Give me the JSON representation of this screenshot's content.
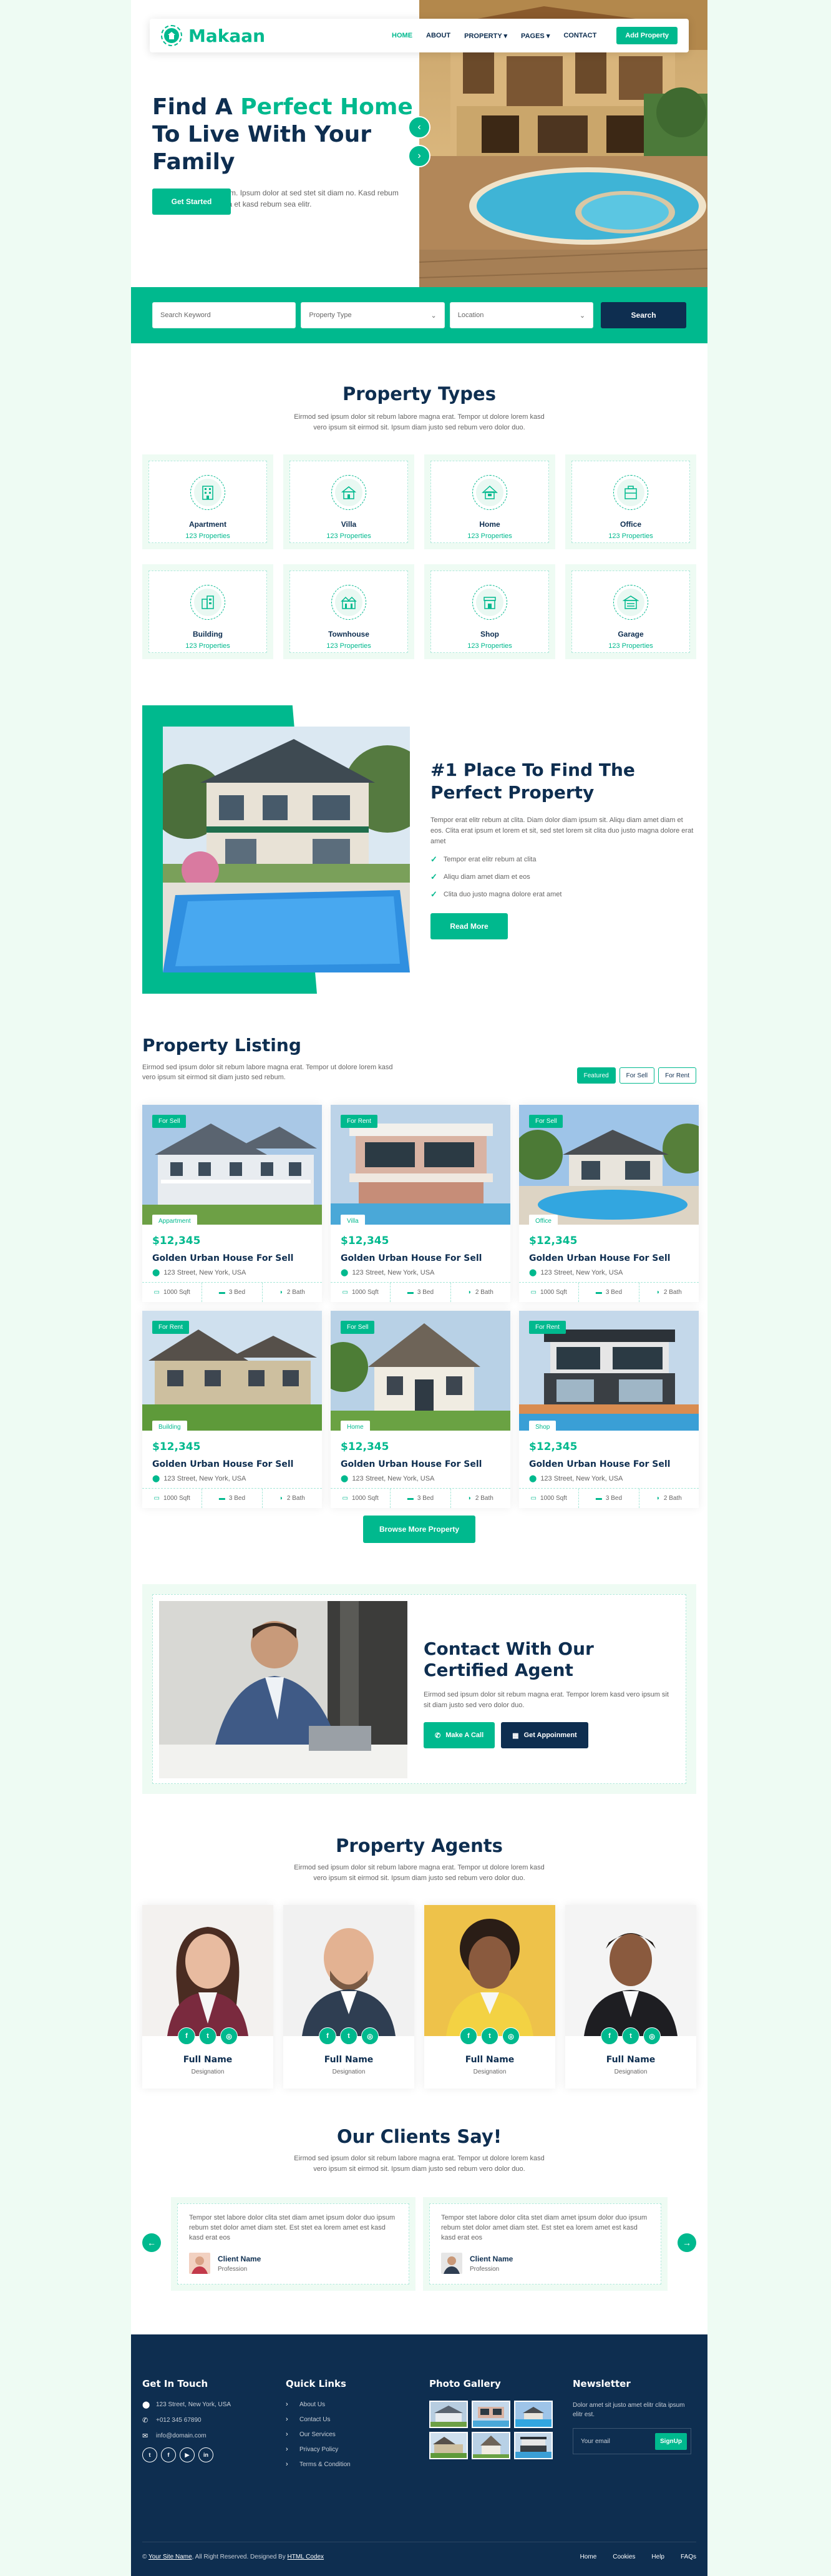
{
  "nav": {
    "brand": "Makaan",
    "links": [
      "HOME",
      "ABOUT",
      "PROPERTY",
      "PAGES",
      "CONTACT"
    ],
    "add_button": "Add Property"
  },
  "hero": {
    "title_part1": "Find A ",
    "title_highlight": "Perfect Home",
    "title_part2": " To Live With Your Family",
    "description": "Vero elitr justo clita lorem. Ipsum dolor at sed stet sit diam no. Kasd rebum ipsum et diam justo clita et kasd rebum sea elitr.",
    "button": "Get Started",
    "arrow_prev": "‹",
    "arrow_next": "›"
  },
  "search": {
    "keyword_placeholder": "Search Keyword",
    "type_select": "Property Type",
    "location_select": "Location",
    "button": "Search"
  },
  "types": {
    "title": "Property Types",
    "subtitle": "Eirmod sed ipsum dolor sit rebum labore magna erat. Tempor ut dolore lorem kasd vero ipsum sit eirmod sit. Ipsum diam justo sed rebum vero dolor duo.",
    "items": [
      {
        "name": "Apartment",
        "count": "123 Properties"
      },
      {
        "name": "Villa",
        "count": "123 Properties"
      },
      {
        "name": "Home",
        "count": "123 Properties"
      },
      {
        "name": "Office",
        "count": "123 Properties"
      },
      {
        "name": "Building",
        "count": "123 Properties"
      },
      {
        "name": "Townhouse",
        "count": "123 Properties"
      },
      {
        "name": "Shop",
        "count": "123 Properties"
      },
      {
        "name": "Garage",
        "count": "123 Properties"
      }
    ]
  },
  "about": {
    "title": "#1 Place To Find The Perfect Property",
    "description": "Tempor erat elitr rebum at clita. Diam dolor diam ipsum sit. Aliqu diam amet diam et eos. Clita erat ipsum et lorem et sit, sed stet lorem sit clita duo justo magna dolore erat amet",
    "checks": [
      "Tempor erat elitr rebum at clita",
      "Aliqu diam amet diam et eos",
      "Clita duo justo magna dolore erat amet"
    ],
    "button": "Read More"
  },
  "listing": {
    "title": "Property Listing",
    "subtitle": "Eirmod sed ipsum dolor sit rebum labore magna erat. Tempor ut dolore lorem kasd vero ipsum sit eirmod sit diam justo sed rebum.",
    "filters": [
      "Featured",
      "For Sell",
      "For Rent"
    ],
    "cards": [
      {
        "tag": "For Sell",
        "type": "Appartment",
        "price": "$12,345",
        "name": "Golden Urban House For Sell",
        "address": "123 Street, New York, USA",
        "sqft": "1000 Sqft",
        "bed": "3 Bed",
        "bath": "2 Bath"
      },
      {
        "tag": "For Rent",
        "type": "Villa",
        "price": "$12,345",
        "name": "Golden Urban House For Sell",
        "address": "123 Street, New York, USA",
        "sqft": "1000 Sqft",
        "bed": "3 Bed",
        "bath": "2 Bath"
      },
      {
        "tag": "For Sell",
        "type": "Office",
        "price": "$12,345",
        "name": "Golden Urban House For Sell",
        "address": "123 Street, New York, USA",
        "sqft": "1000 Sqft",
        "bed": "3 Bed",
        "bath": "2 Bath"
      },
      {
        "tag": "For Rent",
        "type": "Building",
        "price": "$12,345",
        "name": "Golden Urban House For Sell",
        "address": "123 Street, New York, USA",
        "sqft": "1000 Sqft",
        "bed": "3 Bed",
        "bath": "2 Bath"
      },
      {
        "tag": "For Sell",
        "type": "Home",
        "price": "$12,345",
        "name": "Golden Urban House For Sell",
        "address": "123 Street, New York, USA",
        "sqft": "1000 Sqft",
        "bed": "3 Bed",
        "bath": "2 Bath"
      },
      {
        "tag": "For Rent",
        "type": "Shop",
        "price": "$12,345",
        "name": "Golden Urban House For Sell",
        "address": "123 Street, New York, USA",
        "sqft": "1000 Sqft",
        "bed": "3 Bed",
        "bath": "2 Bath"
      }
    ],
    "browse_button": "Browse More Property"
  },
  "contact": {
    "title": "Contact With Our Certified Agent",
    "description": "Eirmod sed ipsum dolor sit rebum magna erat. Tempor lorem kasd vero ipsum sit sit diam justo sed vero dolor duo.",
    "call_button": "Make A Call",
    "appointment_button": "Get Appoinment"
  },
  "agents": {
    "title": "Property Agents",
    "subtitle": "Eirmod sed ipsum dolor sit rebum labore magna erat. Tempor ut dolore lorem kasd vero ipsum sit eirmod sit. Ipsum diam justo sed rebum vero dolor duo.",
    "items": [
      {
        "name": "Full Name",
        "role": "Designation"
      },
      {
        "name": "Full Name",
        "role": "Designation"
      },
      {
        "name": "Full Name",
        "role": "Designation"
      },
      {
        "name": "Full Name",
        "role": "Designation"
      }
    ]
  },
  "testimonials": {
    "title": "Our Clients Say!",
    "subtitle": "Eirmod sed ipsum dolor sit rebum labore magna erat. Tempor ut dolore lorem kasd vero ipsum sit eirmod sit. Ipsum diam justo sed rebum vero dolor duo.",
    "items": [
      {
        "text": "Tempor stet labore dolor clita stet diam amet ipsum dolor duo ipsum rebum stet dolor amet diam stet. Est stet ea lorem amet est kasd kasd erat eos",
        "name": "Client Name",
        "profession": "Profession"
      },
      {
        "text": "Tempor stet labore dolor clita stet diam amet ipsum dolor duo ipsum rebum stet dolor amet diam stet. Est stet ea lorem amet est kasd kasd erat eos",
        "name": "Client Name",
        "profession": "Profession"
      }
    ]
  },
  "footer": {
    "touch_title": "Get In Touch",
    "address": "123 Street, New York, USA",
    "phone": "+012 345 67890",
    "email": "info@domain.com",
    "links_title": "Quick Links",
    "links": [
      "About Us",
      "Contact Us",
      "Our Services",
      "Privacy Policy",
      "Terms & Condition"
    ],
    "gallery_title": "Photo Gallery",
    "newsletter_title": "Newsletter",
    "newsletter_text": "Dolor amet sit justo amet elitr clita ipsum elitr est.",
    "newsletter_placeholder": "Your email",
    "newsletter_button": "SignUp",
    "copyright_prefix": "©",
    "site_name": "Your Site Name",
    "rights": ", All Right Reserved. Designed By",
    "designer": "HTML Codex",
    "menu": [
      "Home",
      "Cookies",
      "Help",
      "FAQs"
    ]
  },
  "colors": {
    "primary": "#00b98e",
    "dark": "#0e2e50",
    "light": "#eefbf3"
  }
}
